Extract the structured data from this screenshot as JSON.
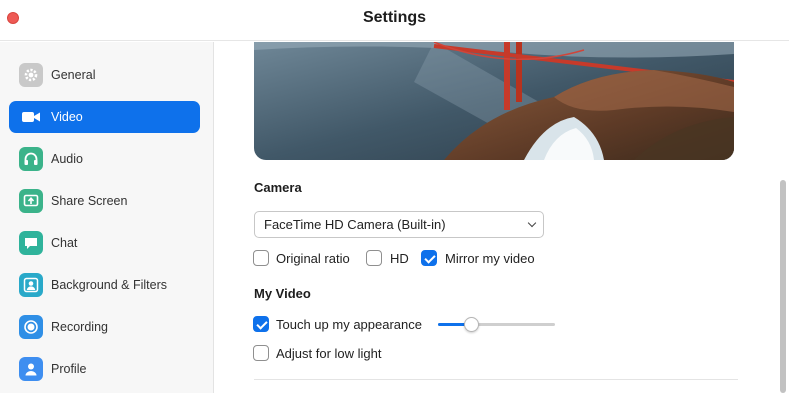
{
  "window": {
    "title": "Settings"
  },
  "sidebar": {
    "items": [
      {
        "label": "General",
        "icon": "gear-icon",
        "active": false
      },
      {
        "label": "Video",
        "icon": "video-camera-icon",
        "active": true
      },
      {
        "label": "Audio",
        "icon": "headphones-icon",
        "active": false
      },
      {
        "label": "Share Screen",
        "icon": "share-screen-icon",
        "active": false
      },
      {
        "label": "Chat",
        "icon": "chat-bubble-icon",
        "active": false
      },
      {
        "label": "Background & Filters",
        "icon": "person-background-icon",
        "active": false
      },
      {
        "label": "Recording",
        "icon": "record-icon",
        "active": false
      },
      {
        "label": "Profile",
        "icon": "profile-icon",
        "active": false
      }
    ]
  },
  "camera": {
    "heading": "Camera",
    "selected_device": "FaceTime HD Camera (Built-in)",
    "options": [
      {
        "label": "Original ratio",
        "checked": false
      },
      {
        "label": "HD",
        "checked": false
      },
      {
        "label": "Mirror my video",
        "checked": true
      }
    ]
  },
  "my_video": {
    "heading": "My Video",
    "touch_up": {
      "label": "Touch up my appearance",
      "checked": true,
      "level": 0.29
    },
    "low_light": {
      "label": "Adjust for low light",
      "checked": false
    }
  },
  "colors": {
    "accent": "#0e71eb",
    "close": "#ee5a55"
  }
}
